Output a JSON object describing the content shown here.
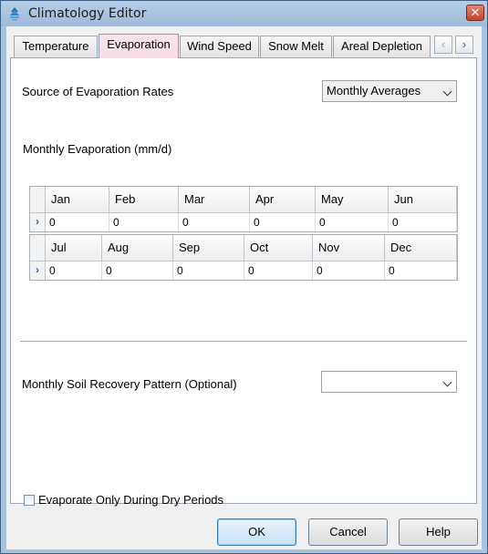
{
  "window": {
    "title": "Climatology Editor",
    "close_glyph": "✕",
    "app_icon": "climatology-app-icon"
  },
  "tabs": [
    {
      "label": "Temperature",
      "active": false
    },
    {
      "label": "Evaporation",
      "active": true
    },
    {
      "label": "Wind Speed",
      "active": false
    },
    {
      "label": "Snow Melt",
      "active": false
    },
    {
      "label": "Areal Depletion",
      "active": false
    }
  ],
  "tab_scroll": {
    "left_glyph": "‹",
    "right_glyph": "›"
  },
  "evaporation": {
    "source_label": "Source of Evaporation Rates",
    "source_value": "Monthly Averages",
    "monthly_label": "Monthly Evaporation (mm/d)",
    "grid1": {
      "months": [
        "Jan",
        "Feb",
        "Mar",
        "Apr",
        "May",
        "Jun"
      ],
      "values": [
        "0",
        "0",
        "0",
        "0",
        "0",
        "0"
      ]
    },
    "grid2": {
      "months": [
        "Jul",
        "Aug",
        "Sep",
        "Oct",
        "Nov",
        "Dec"
      ],
      "values": [
        "0",
        "0",
        "0",
        "0",
        "0",
        "0"
      ]
    },
    "row_selector_glyph": "›",
    "soil_label": "Monthly Soil Recovery Pattern (Optional)",
    "soil_value": "",
    "dry_label": "Evaporate Only During Dry Periods",
    "dry_checked": false
  },
  "buttons": {
    "ok": "OK",
    "cancel": "Cancel",
    "help": "Help"
  },
  "colors": {
    "active_tab": "#fbe3ec",
    "selector_arrow": "#2e5fa8",
    "title_bar": "#a9c3df"
  }
}
